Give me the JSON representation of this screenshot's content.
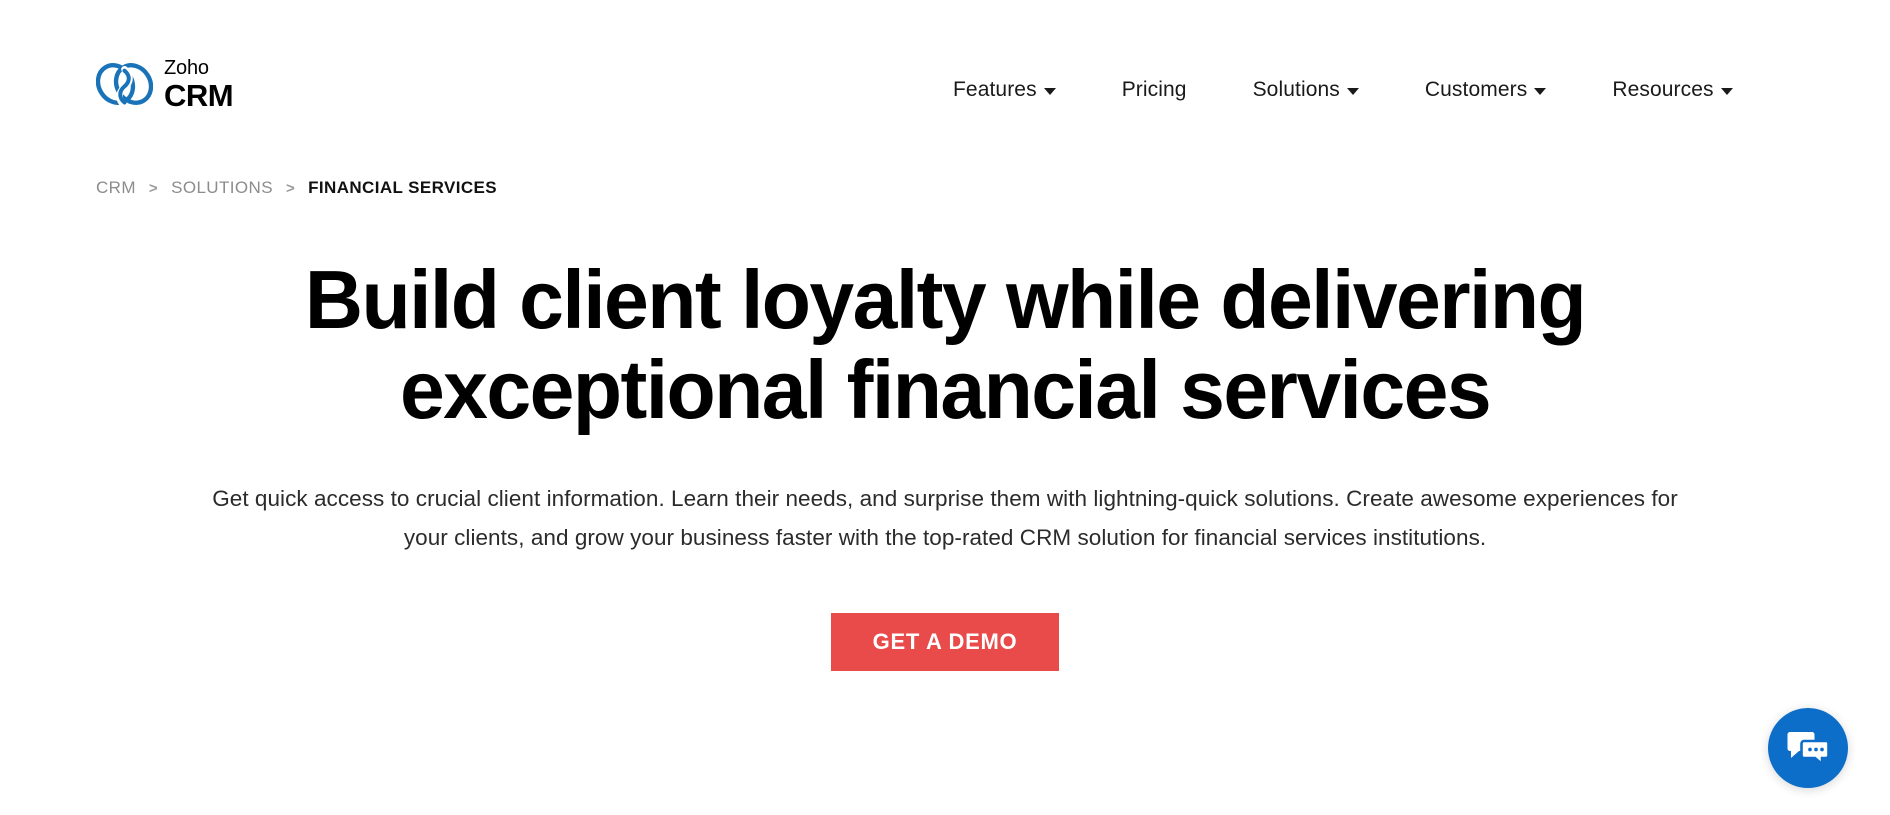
{
  "brand": {
    "logo_icon": "zoho-interlocking-rings-logo",
    "name_top": "Zoho",
    "name_bottom": "CRM",
    "logo_color": "#1a73b8"
  },
  "nav": {
    "items": [
      {
        "label": "Features",
        "has_dropdown": true
      },
      {
        "label": "Pricing",
        "has_dropdown": false
      },
      {
        "label": "Solutions",
        "has_dropdown": true
      },
      {
        "label": "Customers",
        "has_dropdown": true
      },
      {
        "label": "Resources",
        "has_dropdown": true
      }
    ]
  },
  "breadcrumb": {
    "separator": ">",
    "items": [
      {
        "label": "CRM",
        "current": false
      },
      {
        "label": "SOLUTIONS",
        "current": false
      },
      {
        "label": "FINANCIAL SERVICES",
        "current": true
      }
    ]
  },
  "hero": {
    "title_line1": "Build client loyalty while delivering",
    "title_line2": "exceptional financial services",
    "subtitle": "Get quick access to crucial client information. Learn their needs, and surprise them with lightning-quick solutions. Create awesome experiences for your clients, and grow your business faster with the top-rated CRM solution for financial services institutions.",
    "cta_label": "GET A DEMO",
    "cta_color": "#e94b4b"
  },
  "chat": {
    "icon": "chat-bubbles-icon",
    "color": "#0d6ec9"
  }
}
